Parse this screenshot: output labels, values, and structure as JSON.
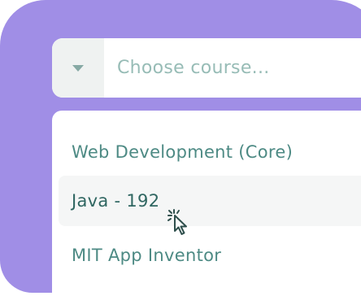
{
  "dropdown": {
    "placeholder": "Choose course...",
    "toggle_icon": "chevron-down-icon",
    "options": [
      {
        "label": "Web Development (Core)",
        "hovered": false
      },
      {
        "label": "Java - 192",
        "hovered": true
      },
      {
        "label": "MIT App Inventor",
        "hovered": false
      }
    ]
  },
  "pointer_icon": "cursor-click-icon",
  "colors": {
    "background_card": "#a08ee6",
    "toggle_bg": "#eff2f1",
    "caret": "#86a9a4",
    "placeholder_text": "#97bcb6",
    "option_text": "#4d8a84",
    "hovered_option_bg": "#f5f6f6",
    "hovered_option_text": "#2f6661",
    "cursor": "#2f4f4c"
  }
}
